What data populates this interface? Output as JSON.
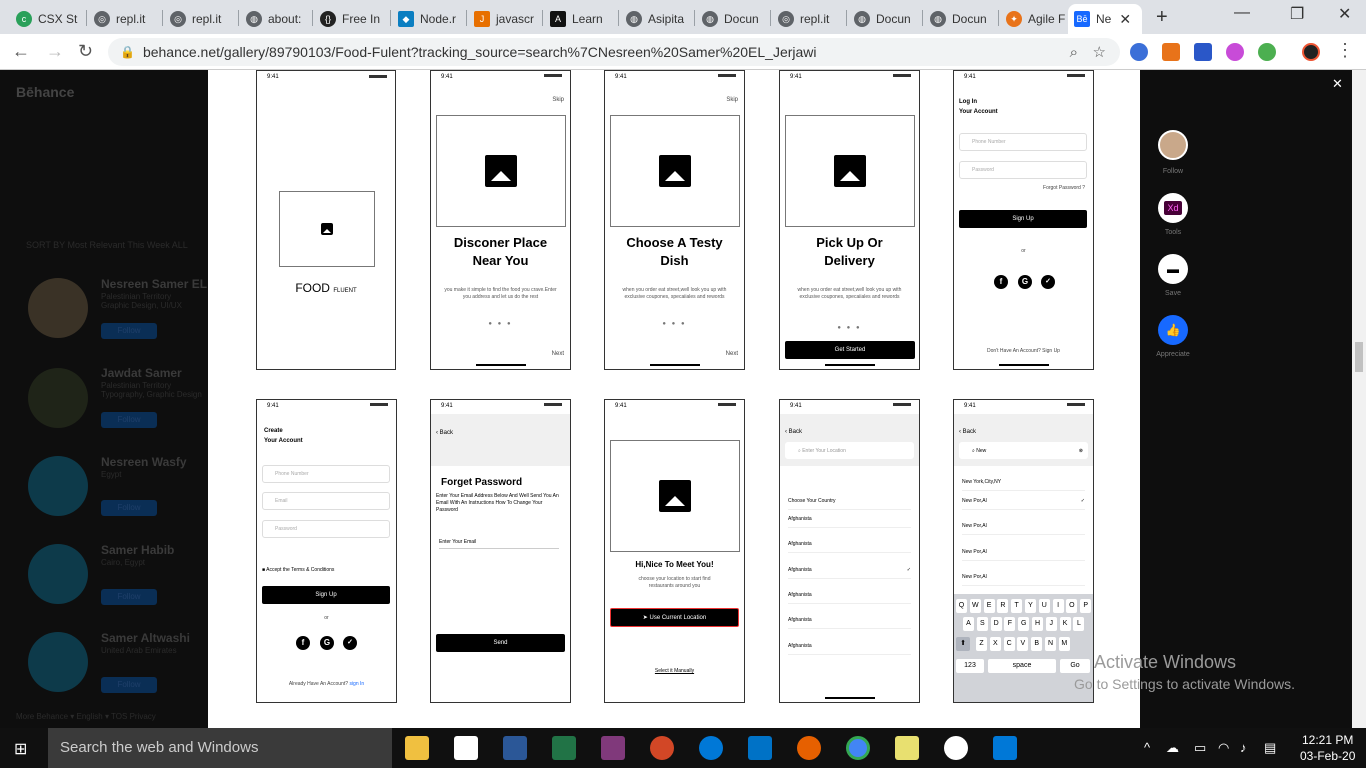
{
  "tabs": [
    {
      "label": "CSX St",
      "icon": "csx-icon"
    },
    {
      "label": "repl.it",
      "icon": "replit-icon"
    },
    {
      "label": "repl.it",
      "icon": "replit-icon"
    },
    {
      "label": "about:",
      "icon": "globe-icon"
    },
    {
      "label": "Free In",
      "icon": "code-braces-icon"
    },
    {
      "label": "Node.r",
      "icon": "node-icon"
    },
    {
      "label": "javascr",
      "icon": "java-icon"
    },
    {
      "label": "Learn",
      "icon": "learn-icon"
    },
    {
      "label": "Asipita",
      "icon": "globe-icon"
    },
    {
      "label": "Docun",
      "icon": "globe-icon"
    },
    {
      "label": "repl.it",
      "icon": "replit-icon"
    },
    {
      "label": "Docun",
      "icon": "globe-icon"
    },
    {
      "label": "Docun",
      "icon": "globe-icon"
    },
    {
      "label": "Agile F",
      "icon": "agile-icon"
    },
    {
      "label": "Ne",
      "icon": "behance-icon",
      "active": true
    }
  ],
  "url": "behance.net/gallery/89790103/Food-Fulent?tracking_source=search%7CNesreen%20Samer%20EL_Jerjawi",
  "background": {
    "logo": "Bēhance",
    "sort": "SORT BY   Most Relevant This Week  ALL",
    "people": [
      {
        "name": "Nesreen Samer EL",
        "meta": "Palestinian Territory\nGraphic Design, UI/UX",
        "follow": "Follow"
      },
      {
        "name": "Jawdat Samer",
        "meta": "Palestinian Territory\nTypography, Graphic Design",
        "follow": "Follow"
      },
      {
        "name": "Nesreen Wasfy",
        "meta": "Egypt",
        "follow": "Follow"
      },
      {
        "name": "Samer Habib",
        "meta": "Cairo, Egypt",
        "follow": "Follow"
      },
      {
        "name": "Samer Altwashi",
        "meta": "United Arab Emirates",
        "follow": "Follow"
      }
    ],
    "footer": "More Behance ▾   English ▾   TOS  Privacy"
  },
  "screens": {
    "time": "9:41",
    "s1": {
      "brand": "FOOD",
      "brand_small": "FLUENT"
    },
    "s2": {
      "skip": "Skip",
      "title1": "Disconer Place",
      "title2": "Near You",
      "desc": "you make it simple to find the food you crave.Enter you address and let us do the rest",
      "next": "Next"
    },
    "s3": {
      "skip": "Skip",
      "title1": "Choose A Testy",
      "title2": "Dish",
      "desc": "when you order eat street,well look you up with exclusive coupones, specaiiales and rewords",
      "next": "Next"
    },
    "s4": {
      "title1": "Pick Up Or",
      "title2": "Delivery",
      "desc": "when you order eat street,well look you up with exclusive coupones, specaiiales and rewords",
      "btn": "Get Started"
    },
    "s5": {
      "h1": "Log In",
      "h2": "Your Account",
      "phone": "Phone Number",
      "password": "Password",
      "forgot": "Forgot Password ?",
      "btn": "Sign Up",
      "or": "or",
      "footer": "Don't Have An Account?   Sign Up"
    },
    "s6": {
      "h1": "Create",
      "h2": "Your Account",
      "phone": "Phone Number",
      "email": "Email",
      "password": "Password",
      "terms": "Accept the Terms & Conditions",
      "btn": "Sign Up",
      "or": "or",
      "footer": "Already Have An Account?",
      "footer_link": "sign In"
    },
    "s7": {
      "back": "Back",
      "title": "Forget Password",
      "desc": "Enter Your Email Address Below And Well Send You An Email With An Instructions  How To Change Your Password",
      "email": "Enter Your Email",
      "btn": "Send"
    },
    "s8": {
      "title": "Hi,Nice To Meet You!",
      "desc": "choose your location to start find restaurants around you",
      "btn": "Use Current Location",
      "link": "Select it Manually"
    },
    "s9": {
      "back": "Back",
      "search": "Enter Your Location",
      "header": "Choose Your Country",
      "rows": [
        "Afghanista",
        "Afghanista",
        "Afghanista",
        "Afghanista",
        "Afghanista",
        "Afghanista"
      ]
    },
    "s10": {
      "back": "Back",
      "search": "New",
      "rows": [
        "New York,City,NY",
        "New Por,Al",
        "New Por,Al",
        "New Por,Al",
        "New Por,Al"
      ],
      "kb1": [
        "Q",
        "W",
        "E",
        "R",
        "T",
        "Y",
        "U",
        "I",
        "O",
        "P"
      ],
      "kb2": [
        "A",
        "S",
        "D",
        "F",
        "G",
        "H",
        "J",
        "K",
        "L"
      ],
      "kb3": [
        "Z",
        "X",
        "C",
        "V",
        "B",
        "N",
        "M"
      ],
      "num": "123",
      "space": "space",
      "go": "Go"
    }
  },
  "right_sidebar": {
    "follow": "Follow",
    "tools": "Tools",
    "save": "Save",
    "appreciate": "Appreciate",
    "tool_badge": "Xd"
  },
  "watermark": {
    "line1": "Activate Windows",
    "line2": "Go to Settings to activate Windows."
  },
  "taskbar": {
    "search": "Search the web and Windows",
    "time": "12:21 PM",
    "date": "03-Feb-20"
  }
}
